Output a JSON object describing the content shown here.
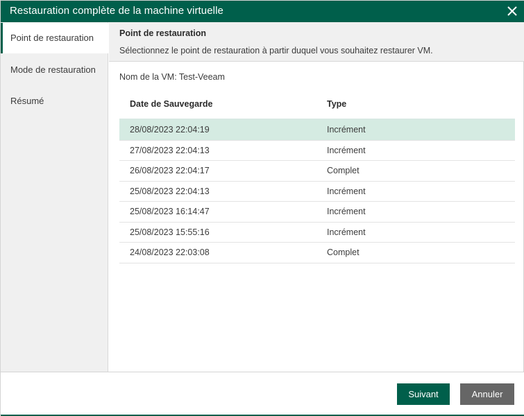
{
  "window": {
    "title": "Restauration complète de la machine virtuelle",
    "accent_color": "#005f4b"
  },
  "sidebar": {
    "items": [
      {
        "label": "Point de restauration",
        "active": true
      },
      {
        "label": "Mode de restauration",
        "active": false
      },
      {
        "label": "Résumé",
        "active": false
      }
    ]
  },
  "header": {
    "title": "Point de restauration",
    "description": "Sélectionnez le point de restauration à partir duquel vous souhaitez restaurer VM."
  },
  "main": {
    "vm_name": "Nom de la VM: Test-Veeam",
    "columns": [
      "Date de Sauvegarde",
      "Type"
    ],
    "rows": [
      {
        "date": "28/08/2023 22:04:19",
        "type": "Incrément",
        "selected": true
      },
      {
        "date": "27/08/2023 22:04:13",
        "type": "Incrément",
        "selected": false
      },
      {
        "date": "26/08/2023 22:04:17",
        "type": "Complet",
        "selected": false
      },
      {
        "date": "25/08/2023 22:04:13",
        "type": "Incrément",
        "selected": false
      },
      {
        "date": "25/08/2023 16:14:47",
        "type": "Incrément",
        "selected": false
      },
      {
        "date": "25/08/2023 15:55:16",
        "type": "Incrément",
        "selected": false
      },
      {
        "date": "24/08/2023 22:03:08",
        "type": "Complet",
        "selected": false
      }
    ]
  },
  "footer": {
    "next_label": "Suivant",
    "cancel_label": "Annuler"
  }
}
